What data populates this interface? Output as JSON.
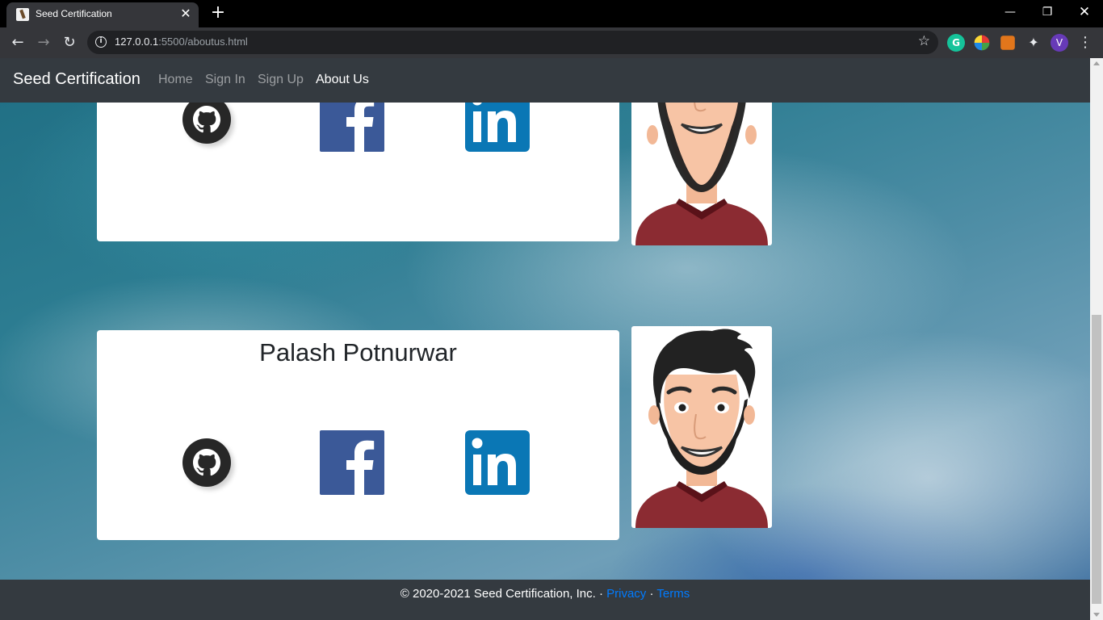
{
  "browser": {
    "tab_title": "Seed Certification",
    "url_host": "127.0.0.1",
    "url_rest": ":5500/aboutus.html",
    "profile_initial": "V"
  },
  "navbar": {
    "brand": "Seed Certification",
    "links": [
      {
        "label": "Home",
        "active": false
      },
      {
        "label": "Sign In",
        "active": false
      },
      {
        "label": "Sign Up",
        "active": false
      },
      {
        "label": "About Us",
        "active": true
      }
    ]
  },
  "members": [
    {
      "name": "",
      "social": [
        "github-icon",
        "facebook-icon",
        "linkedin-icon"
      ]
    },
    {
      "name": "Palash Potnurwar",
      "social": [
        "github-icon",
        "facebook-icon",
        "linkedin-icon"
      ]
    }
  ],
  "footer": {
    "copyright": "© 2020-2021 Seed Certification, Inc. · ",
    "privacy": "Privacy",
    "separator": " · ",
    "terms": "Terms"
  },
  "colors": {
    "navbar_bg": "#343a40",
    "link_color": "#007bff",
    "facebook_blue": "#3b5998",
    "linkedin_blue": "#0a77b5"
  }
}
